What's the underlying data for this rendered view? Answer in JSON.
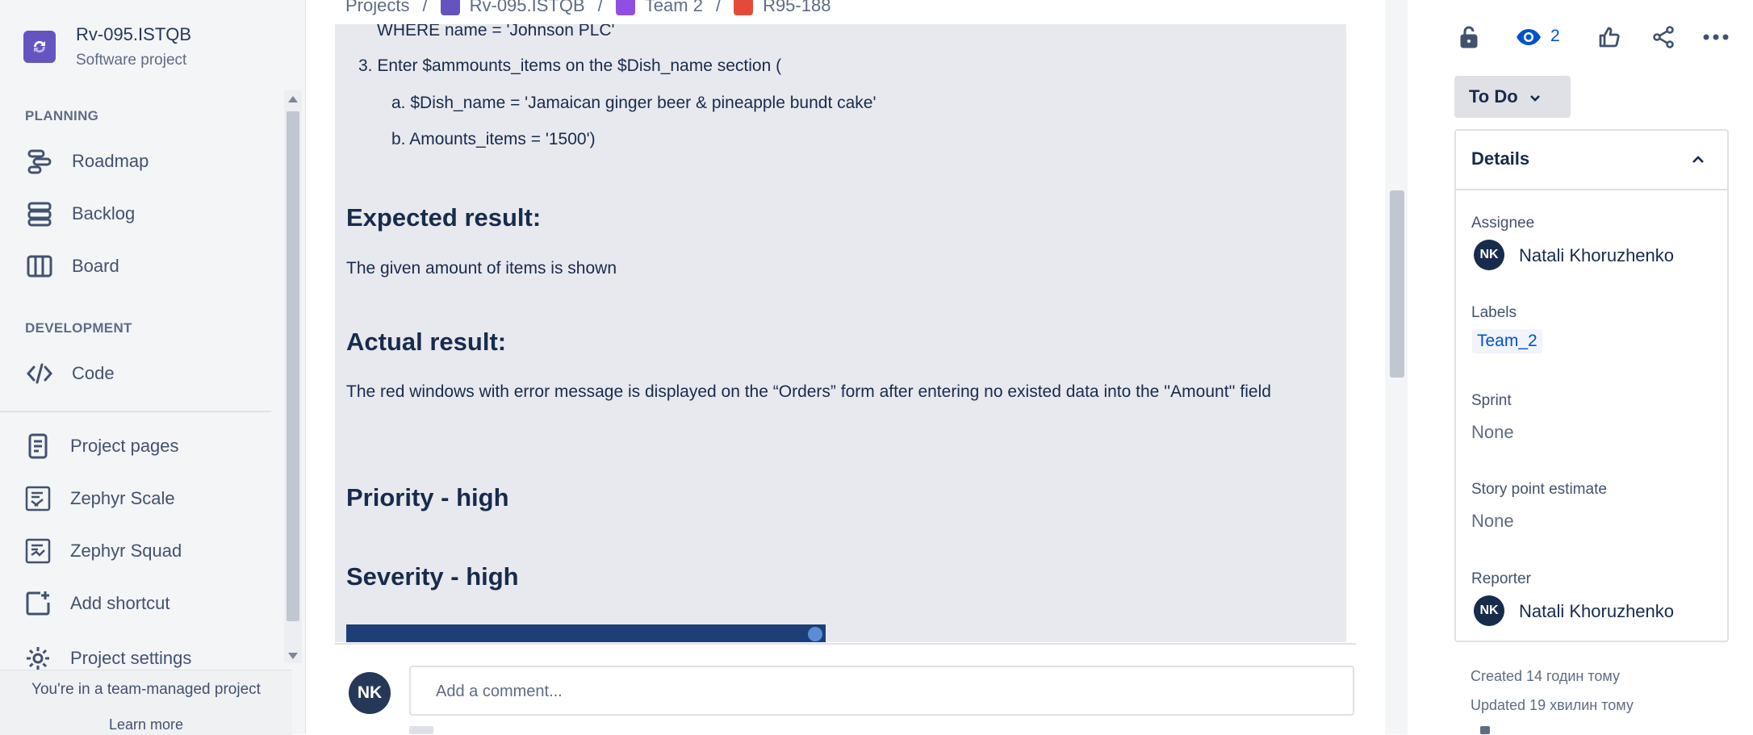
{
  "sidebar": {
    "project_name": "Rv-095.ISTQB",
    "project_type": "Software project",
    "planning_title": "PLANNING",
    "planning_items": [
      {
        "label": "Roadmap",
        "icon": "roadmap-icon"
      },
      {
        "label": "Backlog",
        "icon": "backlog-icon"
      },
      {
        "label": "Board",
        "icon": "board-icon"
      }
    ],
    "development_title": "DEVELOPMENT",
    "development_items": [
      {
        "label": "Code",
        "icon": "code-icon"
      }
    ],
    "other_items": [
      {
        "label": "Project pages",
        "icon": "page-icon"
      },
      {
        "label": "Zephyr Scale",
        "icon": "zephyr-scale-icon"
      },
      {
        "label": "Zephyr Squad",
        "icon": "zephyr-squad-icon"
      },
      {
        "label": "Add shortcut",
        "icon": "add-shortcut-icon"
      },
      {
        "label": "Project settings",
        "icon": "gear-icon"
      }
    ],
    "footer_text": "You're in a team-managed project",
    "learn_more": "Learn more"
  },
  "breadcrumb": {
    "items": [
      "Projects",
      "Rv-095.ISTQB",
      "Team 2",
      "R95-188"
    ],
    "separator": "/"
  },
  "description": {
    "where_line": "WHERE name = 'Johnson PLC'",
    "step3": "3. Enter $ammounts_items on the $Dish_name section (",
    "step3a": "a. $Dish_name = 'Jamaican ginger beer & pineapple bundt cake'",
    "step3b": "b. Amounts_items = '1500')",
    "expected_heading": "Expected result:",
    "expected_text": "The given amount of items is shown",
    "actual_heading": "Actual result:",
    "actual_text": "The red windows with error message is displayed on the “Orders” form after entering no existed data into the ''Amount'' field",
    "priority_heading": "Priority - high",
    "severity_heading": "Severity - high"
  },
  "comment": {
    "avatar_initials": "NK",
    "placeholder": "Add a comment..."
  },
  "right_panel": {
    "watch_count": "2",
    "status": "To Do",
    "details_title": "Details",
    "assignee_label": "Assignee",
    "assignee_initials": "NK",
    "assignee_name": "Natali Khoruzhenko",
    "labels_label": "Labels",
    "label_value": "Team_2",
    "sprint_label": "Sprint",
    "sprint_value": "None",
    "story_points_label": "Story point estimate",
    "story_points_value": "None",
    "reporter_label": "Reporter",
    "reporter_initials": "NK",
    "reporter_name": "Natali Khoruzhenko",
    "created": "Created 14 годин тому",
    "updated": "Updated 19 хвилин тому"
  },
  "colors": {
    "accent": "#0052cc",
    "sidebar_bg": "#f4f5f7",
    "text_primary": "#172b4d",
    "project_avatar": "#6554c0"
  }
}
